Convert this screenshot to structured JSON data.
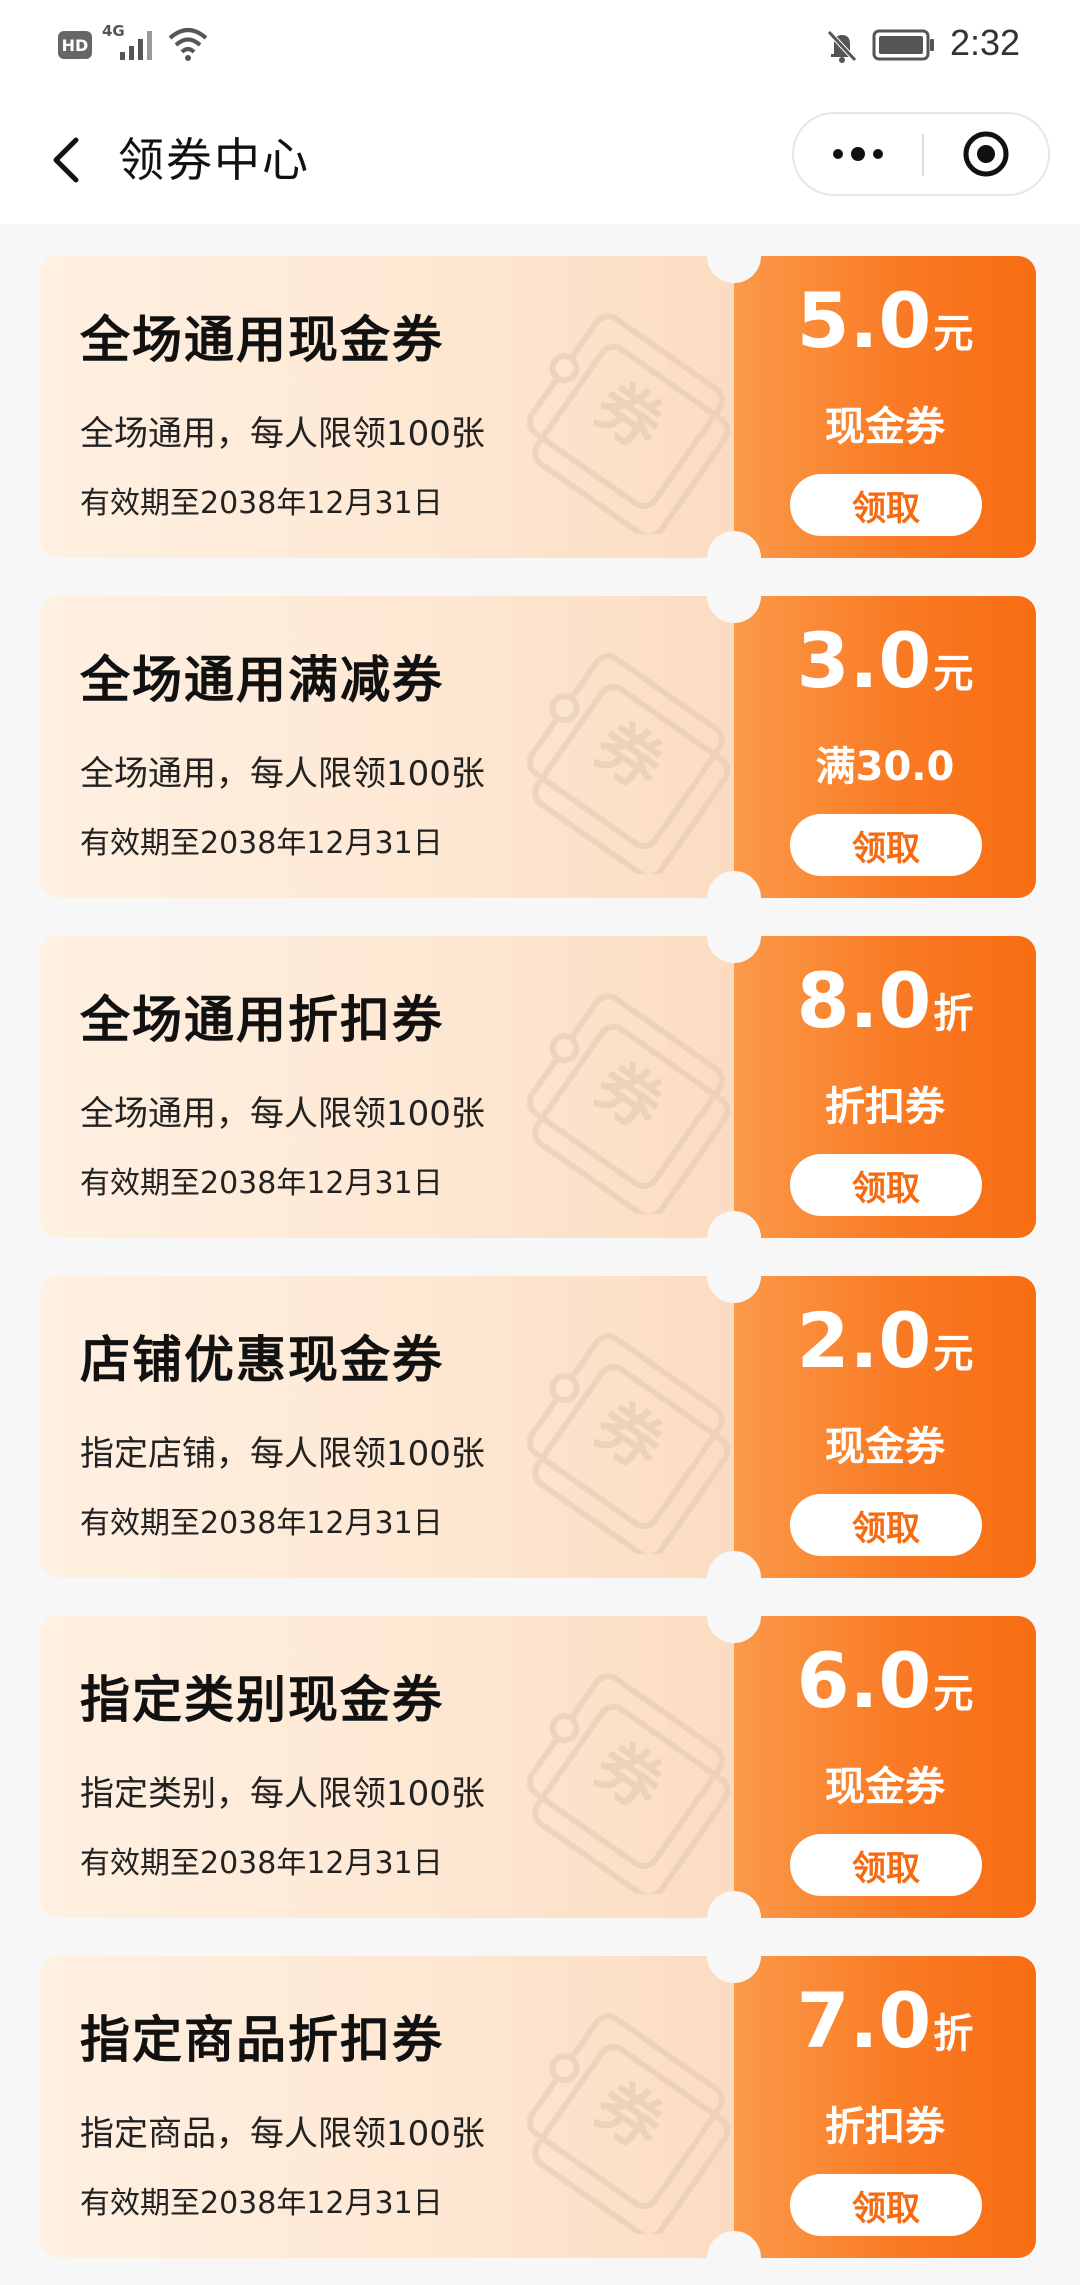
{
  "status_bar": {
    "hd": "HD",
    "network": "4G",
    "time": "2:32"
  },
  "nav": {
    "title": "领券中心"
  },
  "colors": {
    "accent": "#f97a24",
    "card_bg": "#fde7d2",
    "button_text": "#f46b12"
  },
  "coupons": [
    {
      "name": "全场通用现金券",
      "desc": "全场通用，每人限领100张",
      "validity": "有效期至2038年12月31日",
      "amount": "5.0",
      "unit": "元",
      "type_label": "现金券",
      "button": "领取"
    },
    {
      "name": "全场通用满减券",
      "desc": "全场通用，每人限领100张",
      "validity": "有效期至2038年12月31日",
      "amount": "3.0",
      "unit": "元",
      "type_label": "满30.0",
      "button": "领取"
    },
    {
      "name": "全场通用折扣券",
      "desc": "全场通用，每人限领100张",
      "validity": "有效期至2038年12月31日",
      "amount": "8.0",
      "unit": "折",
      "type_label": "折扣券",
      "button": "领取"
    },
    {
      "name": "店铺优惠现金券",
      "desc": "指定店铺，每人限领100张",
      "validity": "有效期至2038年12月31日",
      "amount": "2.0",
      "unit": "元",
      "type_label": "现金券",
      "button": "领取"
    },
    {
      "name": "指定类别现金券",
      "desc": "指定类别，每人限领100张",
      "validity": "有效期至2038年12月31日",
      "amount": "6.0",
      "unit": "元",
      "type_label": "现金券",
      "button": "领取"
    },
    {
      "name": "指定商品折扣券",
      "desc": "指定商品，每人限领100张",
      "validity": "有效期至2038年12月31日",
      "amount": "7.0",
      "unit": "折",
      "type_label": "折扣券",
      "button": "领取"
    }
  ],
  "watermark": {
    "text": "券",
    "icon": "ticket-watermark-icon"
  }
}
